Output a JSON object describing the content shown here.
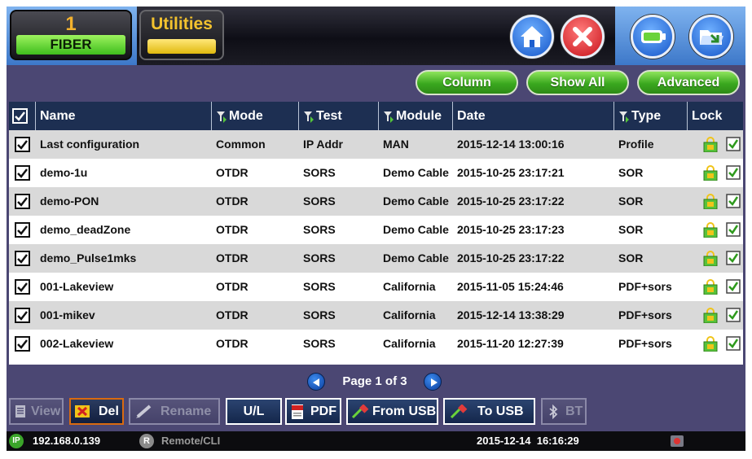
{
  "header": {
    "fiber_tab": {
      "number": "1",
      "label": "FIBER"
    },
    "utilities_tab": {
      "label": "Utilities"
    },
    "buttons": [
      "home-icon",
      "close-icon",
      "battery-icon",
      "folder-icon"
    ]
  },
  "toolbar": {
    "column_label": "Column",
    "show_all_label": "Show All",
    "advanced_label": "Advanced"
  },
  "table": {
    "columns": {
      "name": "Name",
      "mode": "Mode",
      "test": "Test",
      "module": "Module",
      "date": "Date",
      "type": "Type",
      "lock": "Lock"
    },
    "rows": [
      {
        "name": "Last configuration",
        "mode": "Common",
        "test": "IP Addr",
        "module": "MAN",
        "date": "2015-12-14 13:00:16",
        "type": "Profile"
      },
      {
        "name": "demo-1u",
        "mode": "OTDR",
        "test": "SORS",
        "module": "Demo Cable",
        "date": "2015-10-25 23:17:21",
        "type": "SOR"
      },
      {
        "name": "demo-PON",
        "mode": "OTDR",
        "test": "SORS",
        "module": "Demo Cable",
        "date": "2015-10-25 23:17:22",
        "type": "SOR"
      },
      {
        "name": "demo_deadZone",
        "mode": "OTDR",
        "test": "SORS",
        "module": "Demo Cable",
        "date": "2015-10-25 23:17:23",
        "type": "SOR"
      },
      {
        "name": "demo_Pulse1mks",
        "mode": "OTDR",
        "test": "SORS",
        "module": "Demo Cable",
        "date": "2015-10-25 23:17:22",
        "type": "SOR"
      },
      {
        "name": "001-Lakeview",
        "mode": "OTDR",
        "test": "SORS",
        "module": "California",
        "date": "2015-11-05 15:24:46",
        "type": "PDF+sors"
      },
      {
        "name": "001-mikev",
        "mode": "OTDR",
        "test": "SORS",
        "module": "California",
        "date": "2015-12-14 13:38:29",
        "type": "PDF+sors"
      },
      {
        "name": "002-Lakeview",
        "mode": "OTDR",
        "test": "SORS",
        "module": "California",
        "date": "2015-11-20 12:27:39",
        "type": "PDF+sors"
      }
    ]
  },
  "pager": {
    "label": "Page 1 of 3"
  },
  "actions": {
    "view": "View",
    "del": "Del",
    "rename": "Rename",
    "ul": "U/L",
    "pdf": "PDF",
    "from_usb": "From USB",
    "to_usb": "To USB",
    "bt": "BT"
  },
  "status": {
    "ip_badge": "IP",
    "ip": "192.168.0.139",
    "remote_badge": "R",
    "remote": "Remote/CLI",
    "datetime": "2015-12-14  16:16:29"
  },
  "colors": {
    "accent_green": "#3aa81f",
    "header_blue": "#3d78c9",
    "panel_purple": "#4b4773",
    "table_header": "#1d2f52"
  }
}
